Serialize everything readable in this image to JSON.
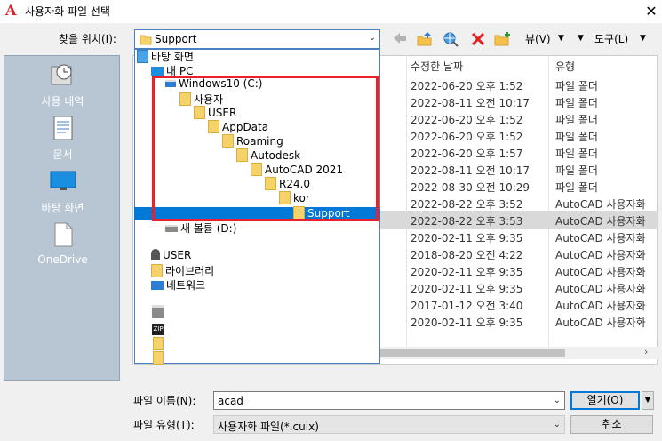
{
  "window": {
    "title": "사용자화 파일 선택",
    "close": "✕"
  },
  "toolbar": {
    "lookin_label": "찾을 위치(I):",
    "lookin_value": "Support",
    "view_menu": "뷰(V)",
    "tools_menu": "도구(L)"
  },
  "places": [
    {
      "label": "사용 내역",
      "icon": "history-icon"
    },
    {
      "label": "문서",
      "icon": "documents-icon"
    },
    {
      "label": "바탕 화면",
      "icon": "desktop-icon"
    },
    {
      "label": "OneDrive",
      "icon": "onedrive-icon"
    }
  ],
  "columns": {
    "modified": "수정한 날짜",
    "type": "유형"
  },
  "rows": [
    {
      "date": "2022-06-20 오후 1:52",
      "type": "파일 폴더"
    },
    {
      "date": "2022-08-11 오전 10:17",
      "type": "파일 폴더"
    },
    {
      "date": "2022-06-20 오후 1:52",
      "type": "파일 폴더"
    },
    {
      "date": "2022-06-20 오후 1:52",
      "type": "파일 폴더"
    },
    {
      "date": "2022-06-20 오후 1:57",
      "type": "파일 폴더"
    },
    {
      "date": "2022-08-11 오전 10:17",
      "type": "파일 폴더"
    },
    {
      "date": "2022-08-30 오전 10:29",
      "type": "파일 폴더"
    },
    {
      "date": "2022-08-22 오후 3:52",
      "type": "AutoCAD 사용자화"
    },
    {
      "date": "2022-08-22 오후 3:53",
      "type": "AutoCAD 사용자화"
    },
    {
      "date": "2020-02-11 오후 9:35",
      "type": "AutoCAD 사용자화"
    },
    {
      "date": "2018-08-20 오전 4:22",
      "type": "AutoCAD 사용자화"
    },
    {
      "date": "2020-02-11 오후 9:35",
      "type": "AutoCAD 사용자화"
    },
    {
      "date": "2020-02-11 오후 9:35",
      "type": "AutoCAD 사용자화"
    },
    {
      "date": "2017-01-12 오전 3:40",
      "type": "AutoCAD 사용자화"
    },
    {
      "date": "2020-02-11 오후 9:35",
      "type": "AutoCAD 사용자화"
    }
  ],
  "tree": {
    "desktop": "바탕 화면",
    "pc": "내 PC",
    "drive_c": "Windows10 (C:)",
    "users": "사용자",
    "user": "USER",
    "appdata": "AppData",
    "roaming": "Roaming",
    "autodesk": "Autodesk",
    "autocad": "AutoCAD 2021",
    "r24": "R24.0",
    "kor": "kor",
    "support": "Support",
    "drive_d": "새 볼륨 (D:)",
    "user2": "USER",
    "library": "라이브러리",
    "network": "네트워크",
    "zip": "ZIP"
  },
  "bottom": {
    "filename_label": "파일 이름(N):",
    "filename_value": "acad",
    "filetype_label": "파일 유형(T):",
    "filetype_value": "사용자화 파일(*.cuix)",
    "open_label": "열기(O)",
    "cancel_label": "취소"
  },
  "colors": {
    "accent": "#0078d7",
    "highlight_box": "#e8212c",
    "places_bg": "#b8c6d4"
  }
}
